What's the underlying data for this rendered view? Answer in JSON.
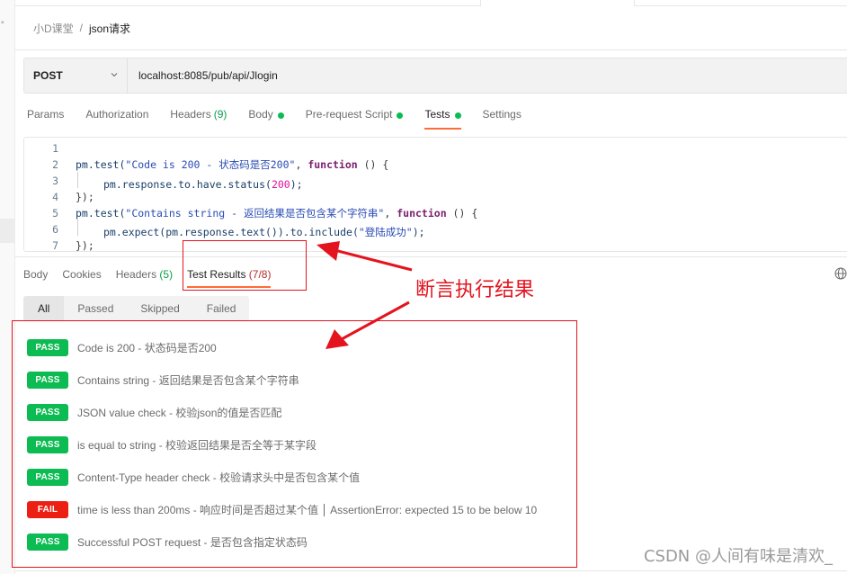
{
  "breadcrumb": {
    "parent": "小D课堂",
    "separator": "/",
    "current": "json请求"
  },
  "request": {
    "method": "POST",
    "url": "localhost:8085/pub/api/Jlogin"
  },
  "request_tabs": [
    {
      "label": "Params"
    },
    {
      "label": "Authorization"
    },
    {
      "label": "Headers",
      "count": "(9)"
    },
    {
      "label": "Body",
      "dot": true
    },
    {
      "label": "Pre-request Script",
      "dot": true
    },
    {
      "label": "Tests",
      "dot": true,
      "active": true
    },
    {
      "label": "Settings"
    }
  ],
  "editor": {
    "line_numbers": [
      "1",
      "2",
      "3",
      "4",
      "5",
      "6",
      "7"
    ],
    "lines": [
      {
        "tokens": []
      },
      {
        "tokens": [
          {
            "t": "obj",
            "v": "pm.test("
          },
          {
            "t": "str",
            "v": "\"Code is 200 - 状态码是否200\""
          },
          {
            "t": "punc",
            "v": ", "
          },
          {
            "t": "kw",
            "v": "function"
          },
          {
            "t": "punc",
            "v": " () {"
          }
        ]
      },
      {
        "indent": true,
        "tokens": [
          {
            "t": "obj",
            "v": "pm.response.to.have.status("
          },
          {
            "t": "num",
            "v": "200"
          },
          {
            "t": "obj",
            "v": ");"
          }
        ]
      },
      {
        "tokens": [
          {
            "t": "punc",
            "v": "});"
          }
        ]
      },
      {
        "tokens": [
          {
            "t": "obj",
            "v": "pm.test("
          },
          {
            "t": "str",
            "v": "\"Contains string - 返回结果是否包含某个字符串\""
          },
          {
            "t": "punc",
            "v": ", "
          },
          {
            "t": "kw",
            "v": "function"
          },
          {
            "t": "punc",
            "v": " () {"
          }
        ]
      },
      {
        "indent": true,
        "tokens": [
          {
            "t": "obj",
            "v": "pm.expect(pm.response.text()).to.include("
          },
          {
            "t": "str",
            "v": "\"登陆成功\""
          },
          {
            "t": "obj",
            "v": ");"
          }
        ]
      },
      {
        "tokens": [
          {
            "t": "punc",
            "v": "});"
          }
        ]
      }
    ]
  },
  "response_tabs": [
    {
      "label": "Body"
    },
    {
      "label": "Cookies"
    },
    {
      "label": "Headers",
      "count": "(5)",
      "count_color": "green"
    },
    {
      "label": "Test Results",
      "count": "(7/8)",
      "count_color": "red",
      "active": true
    }
  ],
  "filter_tabs": [
    {
      "label": "All",
      "active": true
    },
    {
      "label": "Passed"
    },
    {
      "label": "Skipped"
    },
    {
      "label": "Failed"
    }
  ],
  "test_results": [
    {
      "status": "PASS",
      "text": "Code is 200 - 状态码是否200"
    },
    {
      "status": "PASS",
      "text": "Contains string - 返回结果是否包含某个字符串"
    },
    {
      "status": "PASS",
      "text": "JSON value check - 校验json的值是否匹配"
    },
    {
      "status": "PASS",
      "text": "is equal to string - 校验返回结果是否全等于某字段"
    },
    {
      "status": "PASS",
      "text": "Content-Type header check - 校验请求头中是否包含某个值"
    },
    {
      "status": "FAIL",
      "text": "time is less than 200ms - 响应时间是否超过某个值",
      "error": "AssertionError: expected 15 to be below 10"
    },
    {
      "status": "PASS",
      "text": "Successful POST request - 是否包含指定状态码"
    }
  ],
  "annotation": {
    "label": "断言执行结果"
  },
  "watermark": "CSDN @人间有味是清欢_",
  "colors": {
    "accent": "#ff6c37",
    "pass": "#0cbb52",
    "fail": "#eb2013",
    "annotation": "#e3141e"
  }
}
